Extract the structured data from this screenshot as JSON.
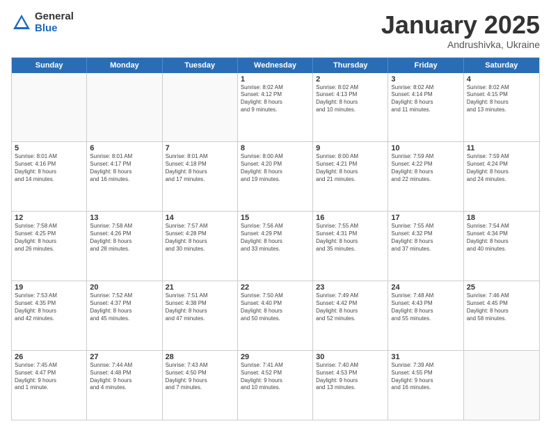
{
  "header": {
    "logo_general": "General",
    "logo_blue": "Blue",
    "month_title": "January 2025",
    "subtitle": "Andrushivka, Ukraine"
  },
  "days_of_week": [
    "Sunday",
    "Monday",
    "Tuesday",
    "Wednesday",
    "Thursday",
    "Friday",
    "Saturday"
  ],
  "rows": [
    [
      {
        "day": "",
        "empty": true
      },
      {
        "day": "",
        "empty": true
      },
      {
        "day": "",
        "empty": true
      },
      {
        "day": "1",
        "text": "Sunrise: 8:02 AM\nSunset: 4:12 PM\nDaylight: 8 hours\nand 9 minutes."
      },
      {
        "day": "2",
        "text": "Sunrise: 8:02 AM\nSunset: 4:13 PM\nDaylight: 8 hours\nand 10 minutes."
      },
      {
        "day": "3",
        "text": "Sunrise: 8:02 AM\nSunset: 4:14 PM\nDaylight: 8 hours\nand 11 minutes."
      },
      {
        "day": "4",
        "text": "Sunrise: 8:02 AM\nSunset: 4:15 PM\nDaylight: 8 hours\nand 13 minutes."
      }
    ],
    [
      {
        "day": "5",
        "text": "Sunrise: 8:01 AM\nSunset: 4:16 PM\nDaylight: 8 hours\nand 14 minutes."
      },
      {
        "day": "6",
        "text": "Sunrise: 8:01 AM\nSunset: 4:17 PM\nDaylight: 8 hours\nand 16 minutes."
      },
      {
        "day": "7",
        "text": "Sunrise: 8:01 AM\nSunset: 4:18 PM\nDaylight: 8 hours\nand 17 minutes."
      },
      {
        "day": "8",
        "text": "Sunrise: 8:00 AM\nSunset: 4:20 PM\nDaylight: 8 hours\nand 19 minutes."
      },
      {
        "day": "9",
        "text": "Sunrise: 8:00 AM\nSunset: 4:21 PM\nDaylight: 8 hours\nand 21 minutes."
      },
      {
        "day": "10",
        "text": "Sunrise: 7:59 AM\nSunset: 4:22 PM\nDaylight: 8 hours\nand 22 minutes."
      },
      {
        "day": "11",
        "text": "Sunrise: 7:59 AM\nSunset: 4:24 PM\nDaylight: 8 hours\nand 24 minutes."
      }
    ],
    [
      {
        "day": "12",
        "text": "Sunrise: 7:58 AM\nSunset: 4:25 PM\nDaylight: 8 hours\nand 26 minutes."
      },
      {
        "day": "13",
        "text": "Sunrise: 7:58 AM\nSunset: 4:26 PM\nDaylight: 8 hours\nand 28 minutes."
      },
      {
        "day": "14",
        "text": "Sunrise: 7:57 AM\nSunset: 4:28 PM\nDaylight: 8 hours\nand 30 minutes."
      },
      {
        "day": "15",
        "text": "Sunrise: 7:56 AM\nSunset: 4:29 PM\nDaylight: 8 hours\nand 33 minutes."
      },
      {
        "day": "16",
        "text": "Sunrise: 7:55 AM\nSunset: 4:31 PM\nDaylight: 8 hours\nand 35 minutes."
      },
      {
        "day": "17",
        "text": "Sunrise: 7:55 AM\nSunset: 4:32 PM\nDaylight: 8 hours\nand 37 minutes."
      },
      {
        "day": "18",
        "text": "Sunrise: 7:54 AM\nSunset: 4:34 PM\nDaylight: 8 hours\nand 40 minutes."
      }
    ],
    [
      {
        "day": "19",
        "text": "Sunrise: 7:53 AM\nSunset: 4:35 PM\nDaylight: 8 hours\nand 42 minutes."
      },
      {
        "day": "20",
        "text": "Sunrise: 7:52 AM\nSunset: 4:37 PM\nDaylight: 8 hours\nand 45 minutes."
      },
      {
        "day": "21",
        "text": "Sunrise: 7:51 AM\nSunset: 4:38 PM\nDaylight: 8 hours\nand 47 minutes."
      },
      {
        "day": "22",
        "text": "Sunrise: 7:50 AM\nSunset: 4:40 PM\nDaylight: 8 hours\nand 50 minutes."
      },
      {
        "day": "23",
        "text": "Sunrise: 7:49 AM\nSunset: 4:42 PM\nDaylight: 8 hours\nand 52 minutes."
      },
      {
        "day": "24",
        "text": "Sunrise: 7:48 AM\nSunset: 4:43 PM\nDaylight: 8 hours\nand 55 minutes."
      },
      {
        "day": "25",
        "text": "Sunrise: 7:46 AM\nSunset: 4:45 PM\nDaylight: 8 hours\nand 58 minutes."
      }
    ],
    [
      {
        "day": "26",
        "text": "Sunrise: 7:45 AM\nSunset: 4:47 PM\nDaylight: 9 hours\nand 1 minute."
      },
      {
        "day": "27",
        "text": "Sunrise: 7:44 AM\nSunset: 4:48 PM\nDaylight: 9 hours\nand 4 minutes."
      },
      {
        "day": "28",
        "text": "Sunrise: 7:43 AM\nSunset: 4:50 PM\nDaylight: 9 hours\nand 7 minutes."
      },
      {
        "day": "29",
        "text": "Sunrise: 7:41 AM\nSunset: 4:52 PM\nDaylight: 9 hours\nand 10 minutes."
      },
      {
        "day": "30",
        "text": "Sunrise: 7:40 AM\nSunset: 4:53 PM\nDaylight: 9 hours\nand 13 minutes."
      },
      {
        "day": "31",
        "text": "Sunrise: 7:39 AM\nSunset: 4:55 PM\nDaylight: 9 hours\nand 16 minutes."
      },
      {
        "day": "",
        "empty": true
      }
    ]
  ]
}
